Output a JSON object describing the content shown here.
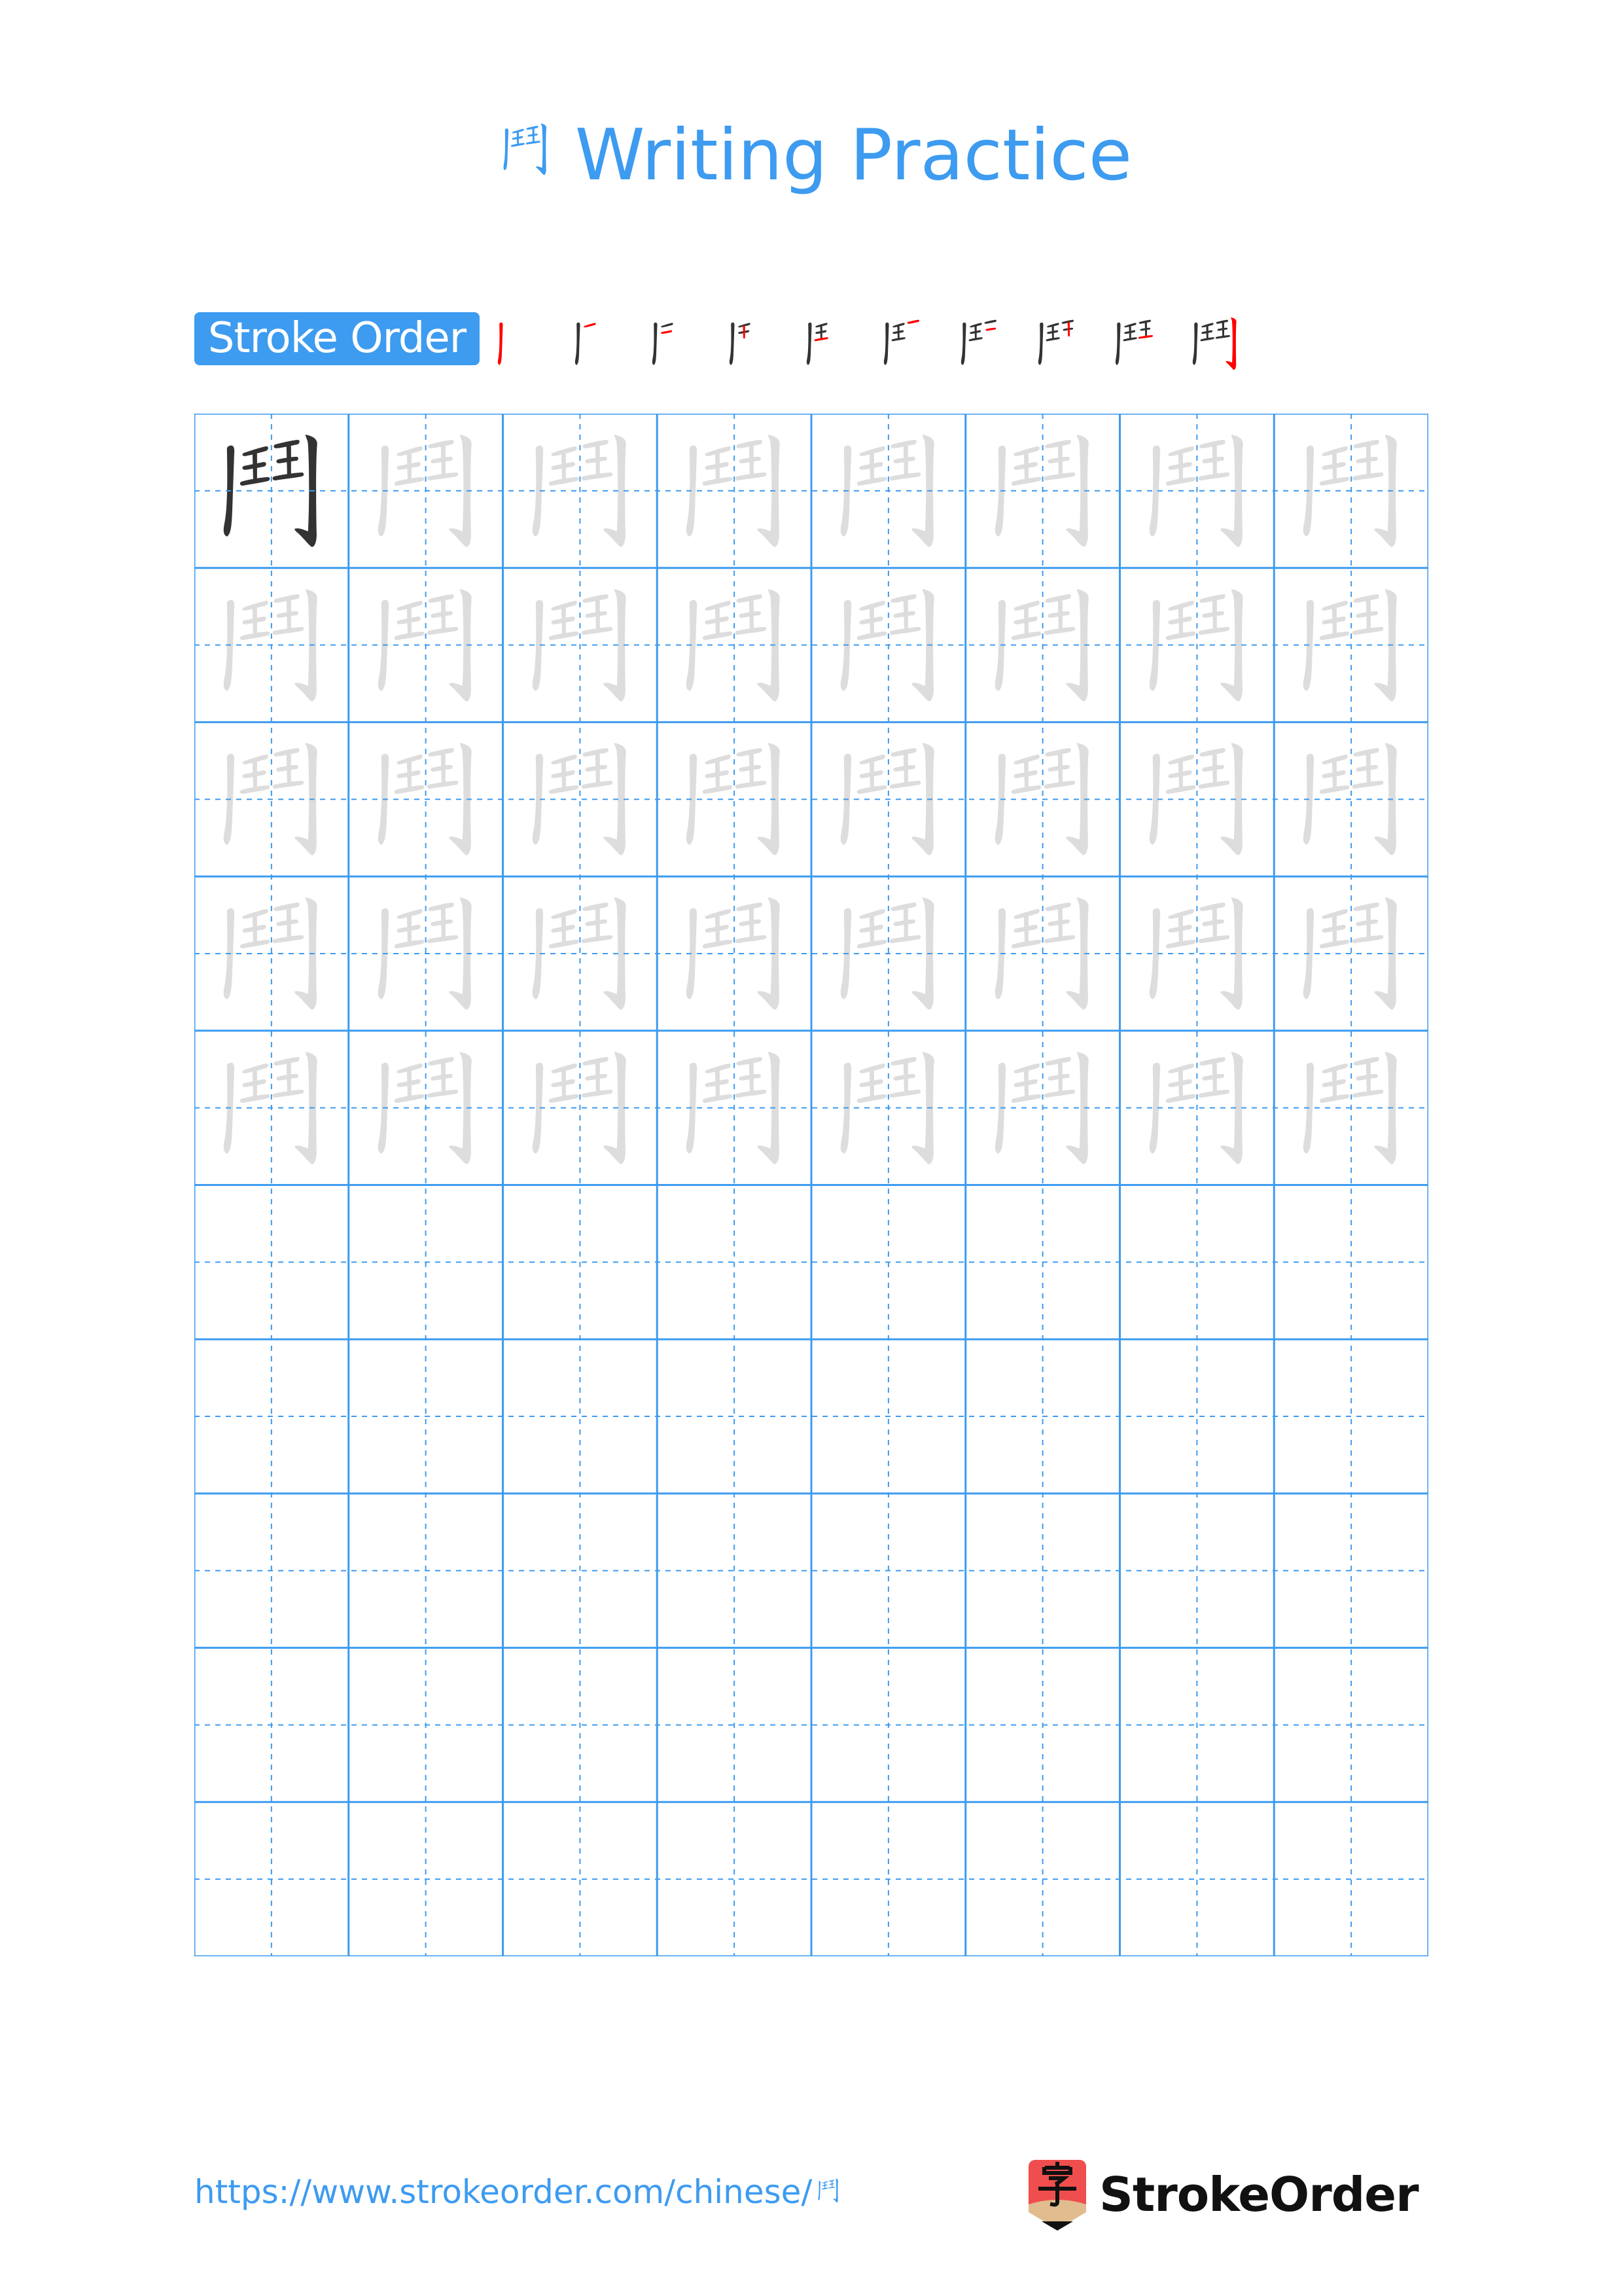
{
  "page": {
    "character": "鬥",
    "title_suffix": "Writing Practice",
    "stroke_order_label": "Stroke Order",
    "stroke_count": 10,
    "grid": {
      "columns": 8,
      "rows": 10,
      "model_cells": 1,
      "trace_rows": 5,
      "empty_rows": 5
    },
    "footer": {
      "url_prefix": "https://www.strokeorder.com/chinese/",
      "url_char": "鬥",
      "brand_name": "StrokeOrder",
      "brand_icon_char": "字"
    },
    "colors": {
      "accent": "#3D9BF0",
      "model_stroke": "#333333",
      "trace_stroke": "#DDDDDD",
      "highlight_stroke": "#FF0000",
      "logo_red": "#F04E4E",
      "logo_wood": "#E0BC8E"
    }
  }
}
